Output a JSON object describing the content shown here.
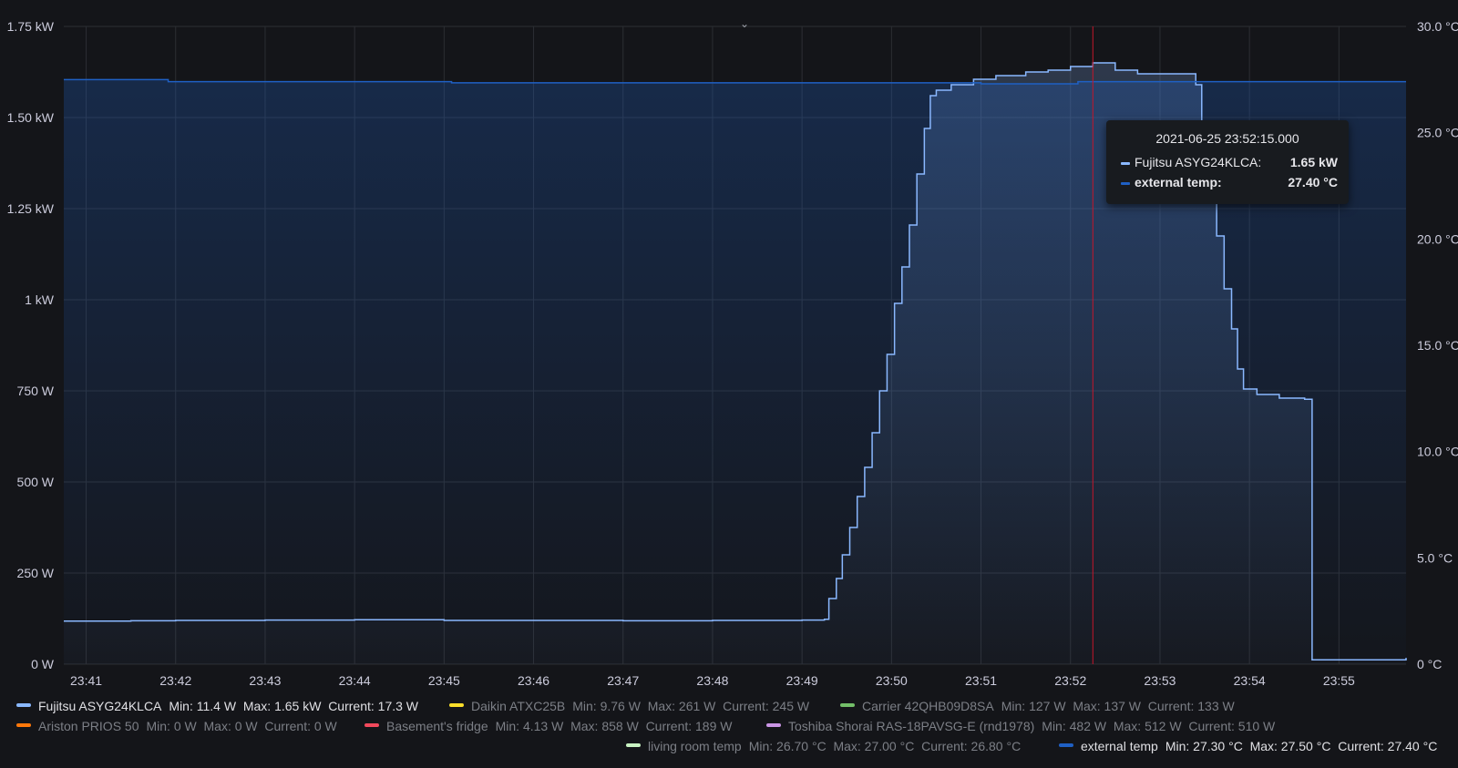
{
  "chart_data": {
    "type": "line",
    "x_unit": "time (2021-06-25)",
    "x_ticks": [
      "23:41",
      "23:42",
      "23:43",
      "23:44",
      "23:45",
      "23:46",
      "23:47",
      "23:48",
      "23:49",
      "23:50",
      "23:51",
      "23:52",
      "23:53",
      "23:54",
      "23:55"
    ],
    "x_range": [
      "23:40:45",
      "23:55:45"
    ],
    "y_left": {
      "min": 0,
      "max": 1750,
      "unit": "W",
      "ticks": [
        {
          "v": 0,
          "label": "0 W"
        },
        {
          "v": 250,
          "label": "250 W"
        },
        {
          "v": 500,
          "label": "500 W"
        },
        {
          "v": 750,
          "label": "750 W"
        },
        {
          "v": 1000,
          "label": "1 kW"
        },
        {
          "v": 1250,
          "label": "1.25 kW"
        },
        {
          "v": 1500,
          "label": "1.50 kW"
        },
        {
          "v": 1750,
          "label": "1.75 kW"
        }
      ]
    },
    "y_right": {
      "min": 0,
      "max": 30,
      "unit": "°C",
      "ticks": [
        {
          "v": 0,
          "label": "0 °C"
        },
        {
          "v": 5,
          "label": "5.0 °C"
        },
        {
          "v": 10,
          "label": "10.0 °C"
        },
        {
          "v": 15,
          "label": "15.0 °C"
        },
        {
          "v": 20,
          "label": "20.0 °C"
        },
        {
          "v": 25,
          "label": "25.0 °C"
        },
        {
          "v": 30,
          "label": "30.0 °C"
        }
      ]
    },
    "grid": true,
    "series": [
      {
        "name": "Fujitsu ASYG24KLCA",
        "axis": "left",
        "color": "#8ab8ff",
        "step": true,
        "points": [
          [
            "23:40:45",
            118
          ],
          [
            "23:41:30",
            119
          ],
          [
            "23:42:00",
            120
          ],
          [
            "23:43:00",
            121
          ],
          [
            "23:44:00",
            122
          ],
          [
            "23:45:00",
            120
          ],
          [
            "23:46:00",
            120
          ],
          [
            "23:47:00",
            119
          ],
          [
            "23:48:00",
            120
          ],
          [
            "23:49:00",
            121
          ],
          [
            "23:49:15",
            123
          ],
          [
            "23:49:18",
            180
          ],
          [
            "23:49:23",
            235
          ],
          [
            "23:49:27",
            300
          ],
          [
            "23:49:32",
            375
          ],
          [
            "23:49:37",
            460
          ],
          [
            "23:49:42",
            540
          ],
          [
            "23:49:47",
            635
          ],
          [
            "23:49:52",
            750
          ],
          [
            "23:49:57",
            850
          ],
          [
            "23:50:02",
            990
          ],
          [
            "23:50:07",
            1090
          ],
          [
            "23:50:12",
            1205
          ],
          [
            "23:50:17",
            1345
          ],
          [
            "23:50:22",
            1470
          ],
          [
            "23:50:26",
            1560
          ],
          [
            "23:50:30",
            1575
          ],
          [
            "23:50:40",
            1590
          ],
          [
            "23:50:55",
            1605
          ],
          [
            "23:51:10",
            1615
          ],
          [
            "23:51:30",
            1625
          ],
          [
            "23:51:45",
            1630
          ],
          [
            "23:52:00",
            1640
          ],
          [
            "23:52:15",
            1650
          ],
          [
            "23:52:30",
            1630
          ],
          [
            "23:52:45",
            1620
          ],
          [
            "23:53:10",
            1620
          ],
          [
            "23:53:24",
            1590
          ],
          [
            "23:53:28",
            1460
          ],
          [
            "23:53:32",
            1325
          ],
          [
            "23:53:38",
            1175
          ],
          [
            "23:53:43",
            1030
          ],
          [
            "23:53:48",
            920
          ],
          [
            "23:53:52",
            810
          ],
          [
            "23:53:56",
            755
          ],
          [
            "23:54:05",
            740
          ],
          [
            "23:54:20",
            730
          ],
          [
            "23:54:37",
            727
          ],
          [
            "23:54:42",
            12
          ],
          [
            "23:55:45",
            17.3
          ]
        ]
      },
      {
        "name": "external temp",
        "axis": "right",
        "color": "#1f60c4",
        "step": true,
        "points": [
          [
            "23:40:45",
            27.5
          ],
          [
            "23:41:55",
            27.4
          ],
          [
            "23:45:05",
            27.35
          ],
          [
            "23:51:00",
            27.3
          ],
          [
            "23:52:05",
            27.4
          ],
          [
            "23:55:45",
            27.4
          ]
        ]
      }
    ]
  },
  "cursor": {
    "time": "23:52:15"
  },
  "tooltip": {
    "time": "2021-06-25 23:52:15.000",
    "rows": [
      {
        "name": "Fujitsu ASYG24KLCA:",
        "value": "1.65 kW",
        "color": "#8ab8ff"
      },
      {
        "name": "external temp:",
        "value": "27.40 °C",
        "color": "#1f60c4"
      }
    ]
  },
  "legend": [
    [
      {
        "name": "Fujitsu ASYG24KLCA",
        "stats": "Min: 11.4 W  Max: 1.65 kW  Current: 17.3 W",
        "color": "#8ab8ff",
        "active": true
      },
      {
        "name": "Daikin ATXC25B",
        "stats": "Min: 9.76 W  Max: 261 W  Current: 245 W",
        "color": "#fade2a",
        "active": false
      },
      {
        "name": "Carrier 42QHB09D8SA",
        "stats": "Min: 127 W  Max: 137 W  Current: 133 W",
        "color": "#73bf69",
        "active": false
      }
    ],
    [
      {
        "name": "Ariston PRIOS 50",
        "stats": "Min: 0 W  Max: 0 W  Current: 0 W",
        "color": "#ff780a",
        "active": false
      },
      {
        "name": "Basement's fridge",
        "stats": "Min: 4.13 W  Max: 858 W  Current: 189 W",
        "color": "#f2495c",
        "active": false
      },
      {
        "name": "Toshiba Shorai RAS-18PAVSG-E (rnd1978)",
        "stats": "Min: 482 W  Max: 512 W  Current: 510 W",
        "color": "#ca95e5",
        "active": false
      }
    ],
    [
      {
        "name": "living room temp",
        "stats": "Min: 26.70 °C  Max: 27.00 °C  Current: 26.80 °C",
        "color": "#c8f2c2",
        "active": false
      },
      {
        "name": "external temp",
        "stats": "Min: 27.30 °C  Max: 27.50 °C  Current: 27.40 °C",
        "color": "#1f60c4",
        "active": true
      }
    ]
  ],
  "header": {
    "collapse_icon": "chevron-down-icon",
    "collapse_glyph": "⌄"
  }
}
